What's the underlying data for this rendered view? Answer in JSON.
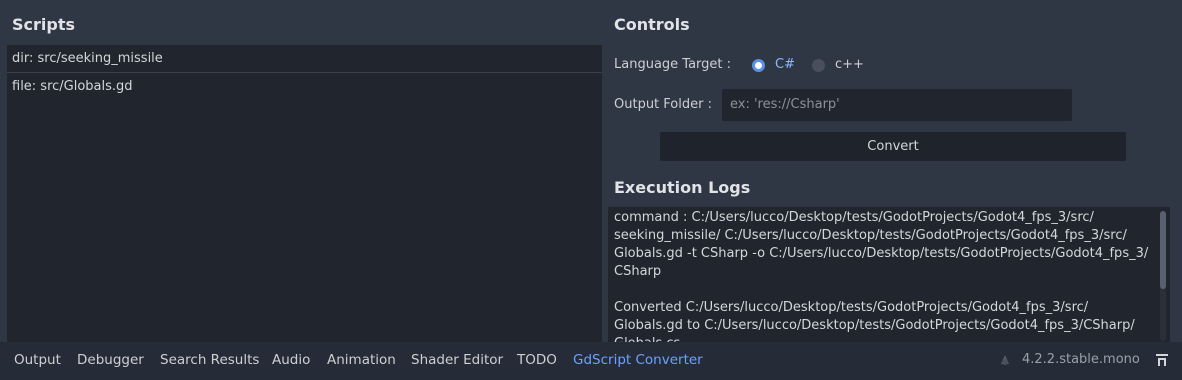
{
  "scripts": {
    "title": "Scripts",
    "items": [
      {
        "label": "dir:  src/seeking_missile"
      },
      {
        "label": "file: src/Globals.gd"
      }
    ]
  },
  "controls": {
    "title": "Controls",
    "language_label": "Language Target :",
    "lang_csharp": "C#",
    "lang_cpp": "c++",
    "selected_lang": "C#",
    "output_label": "Output Folder :",
    "output_placeholder": "ex: 'res://Csharp'",
    "output_value": "",
    "convert_label": "Convert"
  },
  "logs": {
    "title": "Execution Logs",
    "text": "command : C:/Users/lucco/Desktop/tests/GodotProjects/Godot4_fps_3/src/\nseeking_missile/ C:/Users/lucco/Desktop/tests/GodotProjects/Godot4_fps_3/src/\nGlobals.gd -t CSharp -o C:/Users/lucco/Desktop/tests/GodotProjects/Godot4_fps_3/\nCSharp\n\nConverted C:/Users/lucco/Desktop/tests/GodotProjects/Godot4_fps_3/src/\nGlobals.gd to C:/Users/lucco/Desktop/tests/GodotProjects/Godot4_fps_3/CSharp/\nGlobals.cs"
  },
  "bottom_panel": {
    "tabs": [
      "Output",
      "Debugger",
      "Search Results",
      "Audio",
      "Animation",
      "Shader Editor",
      "TODO",
      "GdScript Converter"
    ],
    "active_tab": "GdScript Converter",
    "version": "4.2.2.stable.mono"
  },
  "colors": {
    "accent": "#6aa2ff",
    "panel_bg": "#2f3644",
    "field_bg": "#21262e"
  },
  "icons": {
    "version": "godot-update-spinner-icon",
    "pin": "expand-bottom-panel-icon"
  }
}
